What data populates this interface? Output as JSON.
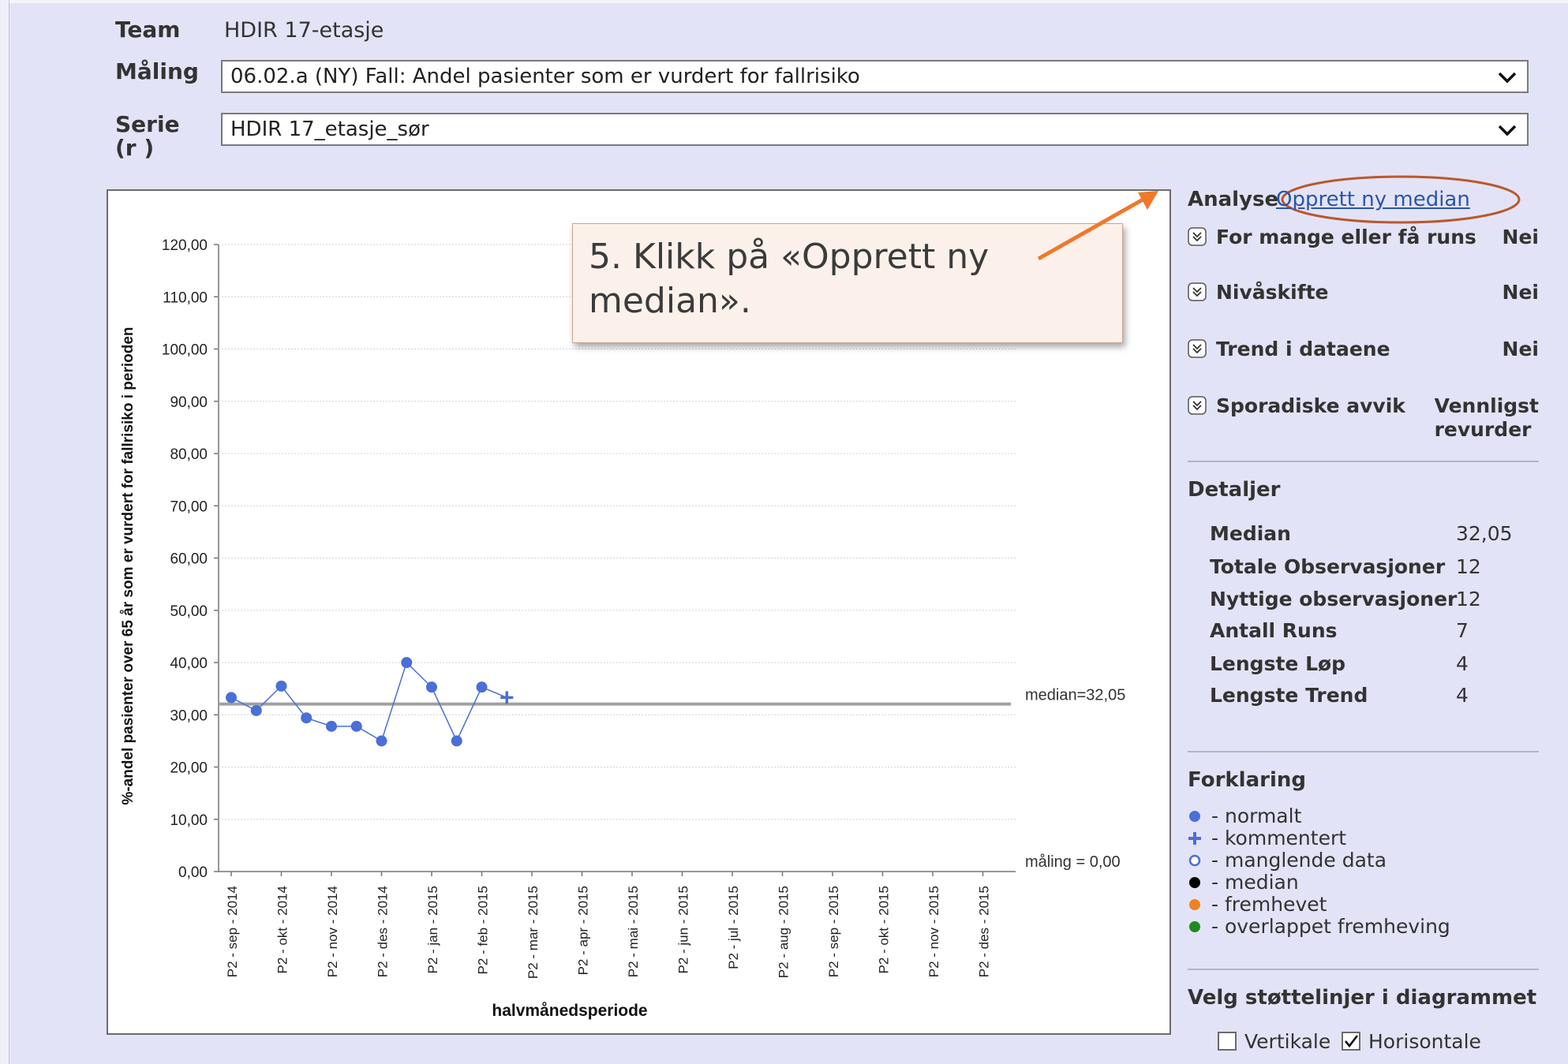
{
  "header": {
    "team_label": "Team",
    "team_value": "HDIR 17-etasje",
    "maling_label": "Måling",
    "maling_value": "06.02.a (NY) Fall: Andel pasienter som er vurdert for fallrisiko",
    "serie_label": "Serie",
    "serie_sub": "(r )",
    "serie_value": "HDIR 17_etasje_sør"
  },
  "callout": {
    "text_line1": "5. Klikk på «Opprett ny",
    "text_line2": "median»."
  },
  "analysis": {
    "title": "Analyse",
    "link": "Opprett ny median",
    "rows": [
      {
        "name": "For mange eller få runs",
        "value": "Nei"
      },
      {
        "name": "Nivåskifte",
        "value": "Nei"
      },
      {
        "name": "Trend i dataene",
        "value": "Nei"
      },
      {
        "name": "Sporadiske avvik",
        "value_line1": "Vennligst",
        "value_line2": "revurder"
      }
    ]
  },
  "details": {
    "title": "Detaljer",
    "rows": [
      {
        "label": "Median",
        "value": "32,05"
      },
      {
        "label": "Totale Observasjoner",
        "value": "12"
      },
      {
        "label": "Nyttige observasjoner",
        "value": "12"
      },
      {
        "label": "Antall Runs",
        "value": "7"
      },
      {
        "label": "Lengste Løp",
        "value": "4"
      },
      {
        "label": "Lengste Trend",
        "value": "4"
      }
    ]
  },
  "legend": {
    "title": "Forklaring",
    "items": [
      {
        "label": "- normalt",
        "icon": "filled-dot-icon",
        "color": "#4a6fd6"
      },
      {
        "label": "- kommentert",
        "icon": "plus-icon",
        "color": "#4a6fd6"
      },
      {
        "label": "- manglende data",
        "icon": "hollow-dot-icon",
        "color": "#4a6fd6"
      },
      {
        "label": "- median",
        "icon": "filled-dot-icon",
        "color": "#000000"
      },
      {
        "label": "- fremhevet",
        "icon": "filled-dot-icon",
        "color": "#f0821e"
      },
      {
        "label": "- overlappet fremheving",
        "icon": "filled-dot-icon",
        "color": "#1f8a1f"
      }
    ]
  },
  "gridlines": {
    "title": "Velg støttelinjer i diagrammet",
    "vertical_label": "Vertikale",
    "vertical_checked": false,
    "horizontal_label": "Horisontale",
    "horizontal_checked": true
  },
  "colors": {
    "background": "#e3e3f7",
    "link": "#2a56a8",
    "series": "#4a6fd6",
    "annotation": "#f0782a",
    "ellipse": "#b9582c"
  },
  "chart_data": {
    "type": "line",
    "ylabel": "%-andel pasienter over 65 år som er vurdert for fallrisiko i perioden",
    "xlabel": "halvmånedsperiode",
    "ylim": [
      0,
      120
    ],
    "yticks": [
      "0,00",
      "10,00",
      "20,00",
      "30,00",
      "40,00",
      "50,00",
      "60,00",
      "70,00",
      "80,00",
      "90,00",
      "100,00",
      "110,00",
      "120,00"
    ],
    "categories": [
      "P2 - sep - 2014",
      "P2 - okt - 2014",
      "P2 - nov - 2014",
      "P2 - des - 2014",
      "P2 - jan - 2015",
      "P2 - feb - 2015",
      "P2 - mar - 2015",
      "P2 - apr - 2015",
      "P2 - mai - 2015",
      "P2 - jun - 2015",
      "P2 - jul - 2015",
      "P2 - aug - 2015",
      "P2 - sep - 2015",
      "P2 - okt - 2015",
      "P2 - nov - 2015",
      "P2 - des - 2015"
    ],
    "series": [
      {
        "values": [
          33.3,
          30.8,
          35.5,
          29.4,
          27.8,
          27.8,
          25.0,
          40.0,
          35.3,
          25.0,
          35.3,
          33.3
        ],
        "markers": [
          "dot",
          "dot",
          "dot",
          "dot",
          "dot",
          "dot",
          "dot",
          "dot",
          "dot",
          "dot",
          "dot",
          "plus"
        ]
      }
    ],
    "median": 32.05,
    "median_label": "median=32,05",
    "maling_label": "måling = 0,00",
    "grid": "horizontal"
  }
}
